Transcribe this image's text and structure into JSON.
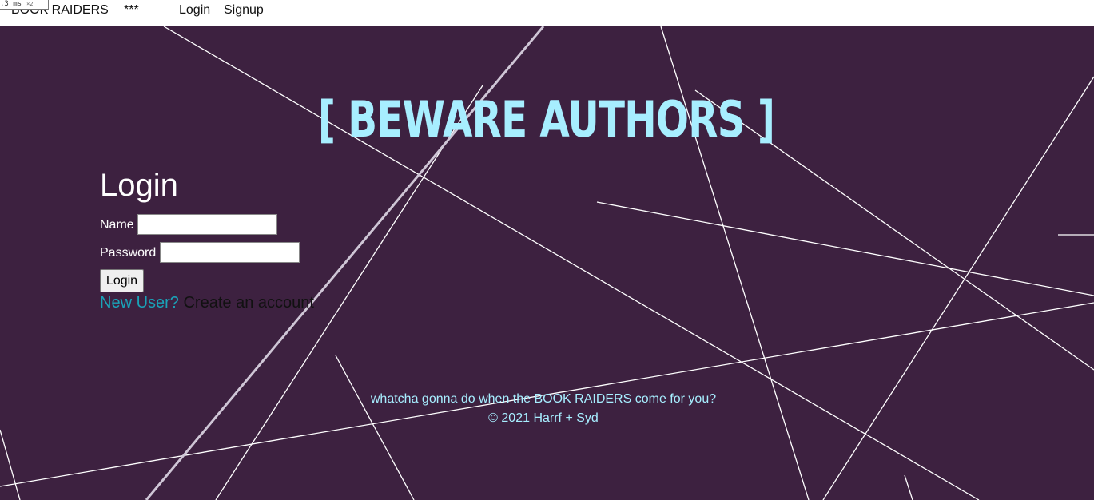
{
  "devtools": {
    "fps_readout": ".3 ms",
    "fps_multiplier": "×2"
  },
  "nav": {
    "brand": "BOOK RAIDERS",
    "stars": "***",
    "login": "Login",
    "signup": "Signup"
  },
  "hero": {
    "headline": "[ BEWARE AUTHORS ]"
  },
  "login_form": {
    "title": "Login",
    "name_label": "Name",
    "name_value": "",
    "password_label": "Password",
    "password_value": "",
    "submit_label": "Login",
    "new_user_text": "New User?",
    "create_account_link": "Create an account"
  },
  "footer": {
    "tagline": "whatcha gonna do when the BOOK RAIDERS come for you?",
    "copyright": "© 2021 Harrf + Syd"
  },
  "colors": {
    "background": "#3d2140",
    "headline": "#a7eeff",
    "new_user": "#1aa3b8",
    "footer_text": "#a7eeff",
    "lines": "#ffffff"
  }
}
